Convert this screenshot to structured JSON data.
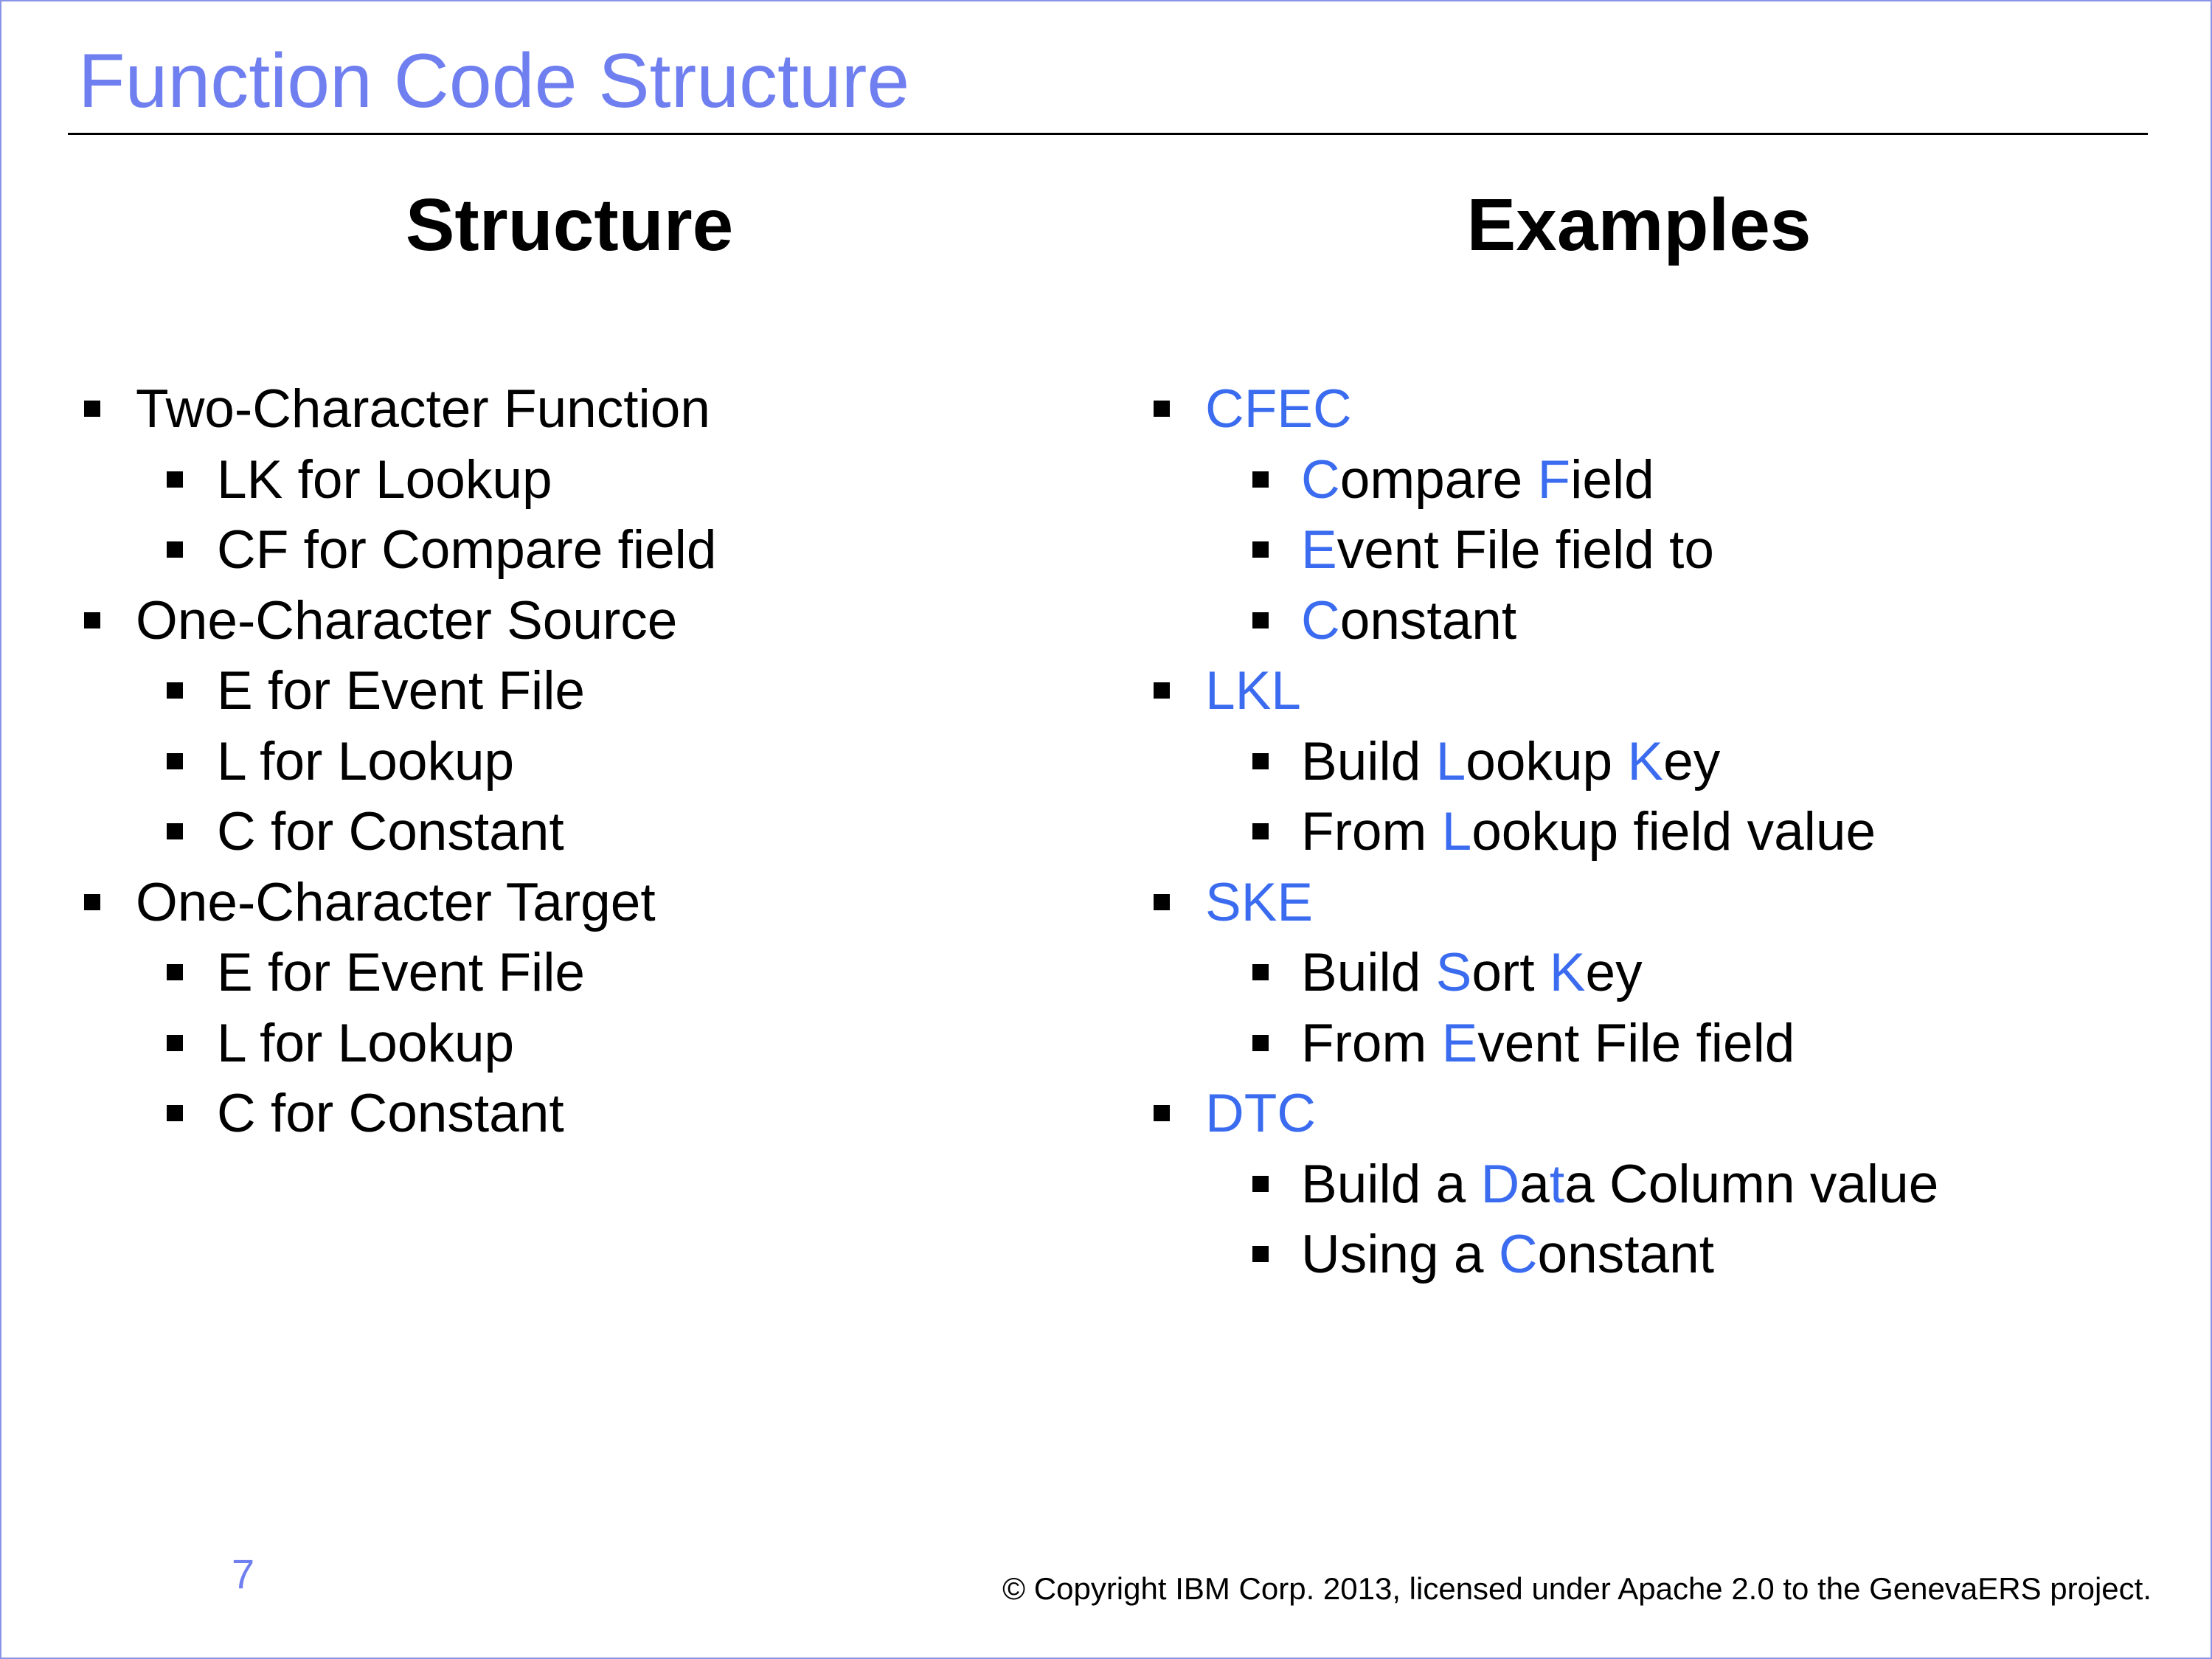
{
  "slide": {
    "title": "Function Code Structure",
    "page_number": "7",
    "copyright": "© Copyright IBM Corp. 2013, licensed under Apache 2.0 to the GenevaERS project."
  },
  "structure": {
    "heading": "Structure",
    "items": [
      {
        "level": 1,
        "segments": [
          {
            "text": "Two-Character Function",
            "highlight": false
          }
        ]
      },
      {
        "level": 2,
        "segments": [
          {
            "text": "LK for Lookup",
            "highlight": false
          }
        ]
      },
      {
        "level": 2,
        "segments": [
          {
            "text": "CF for Compare field",
            "highlight": false
          }
        ]
      },
      {
        "level": 1,
        "segments": [
          {
            "text": "One-Character Source",
            "highlight": false
          }
        ]
      },
      {
        "level": 2,
        "segments": [
          {
            "text": "E for Event File",
            "highlight": false
          }
        ]
      },
      {
        "level": 2,
        "segments": [
          {
            "text": "L for Lookup",
            "highlight": false
          }
        ]
      },
      {
        "level": 2,
        "segments": [
          {
            "text": "C for Constant",
            "highlight": false
          }
        ]
      },
      {
        "level": 1,
        "segments": [
          {
            "text": "One-Character Target",
            "highlight": false
          }
        ]
      },
      {
        "level": 2,
        "segments": [
          {
            "text": "E for Event File",
            "highlight": false
          }
        ]
      },
      {
        "level": 2,
        "segments": [
          {
            "text": "L for Lookup",
            "highlight": false
          }
        ]
      },
      {
        "level": 2,
        "segments": [
          {
            "text": "C for Constant",
            "highlight": false
          }
        ]
      }
    ]
  },
  "examples": {
    "heading": "Examples",
    "items": [
      {
        "level": 1,
        "segments": [
          {
            "text": "CFEC",
            "highlight": true
          }
        ]
      },
      {
        "level": 2,
        "segments": [
          {
            "text": "C",
            "highlight": true
          },
          {
            "text": "ompare ",
            "highlight": false
          },
          {
            "text": "F",
            "highlight": true
          },
          {
            "text": "ield",
            "highlight": false
          }
        ]
      },
      {
        "level": 2,
        "segments": [
          {
            "text": "E",
            "highlight": true
          },
          {
            "text": "vent File field to",
            "highlight": false
          }
        ]
      },
      {
        "level": 2,
        "segments": [
          {
            "text": "C",
            "highlight": true
          },
          {
            "text": "onstant",
            "highlight": false
          }
        ]
      },
      {
        "level": 1,
        "segments": [
          {
            "text": "LKL",
            "highlight": true
          }
        ]
      },
      {
        "level": 2,
        "segments": [
          {
            "text": "Build ",
            "highlight": false
          },
          {
            "text": "L",
            "highlight": true
          },
          {
            "text": "ookup ",
            "highlight": false
          },
          {
            "text": "K",
            "highlight": true
          },
          {
            "text": "ey",
            "highlight": false
          }
        ]
      },
      {
        "level": 2,
        "segments": [
          {
            "text": "From ",
            "highlight": false
          },
          {
            "text": "L",
            "highlight": true
          },
          {
            "text": "ookup field value",
            "highlight": false
          }
        ]
      },
      {
        "level": 1,
        "segments": [
          {
            "text": "SKE",
            "highlight": true
          }
        ]
      },
      {
        "level": 2,
        "segments": [
          {
            "text": "Build ",
            "highlight": false
          },
          {
            "text": "S",
            "highlight": true
          },
          {
            "text": "ort ",
            "highlight": false
          },
          {
            "text": "K",
            "highlight": true
          },
          {
            "text": "ey",
            "highlight": false
          }
        ]
      },
      {
        "level": 2,
        "segments": [
          {
            "text": "From ",
            "highlight": false
          },
          {
            "text": "E",
            "highlight": true
          },
          {
            "text": "vent File field",
            "highlight": false
          }
        ]
      },
      {
        "level": 1,
        "segments": [
          {
            "text": "DTC",
            "highlight": true
          }
        ]
      },
      {
        "level": 2,
        "segments": [
          {
            "text": "Build a ",
            "highlight": false
          },
          {
            "text": "D",
            "highlight": true
          },
          {
            "text": "a",
            "highlight": false
          },
          {
            "text": "t",
            "highlight": true
          },
          {
            "text": "a Column value",
            "highlight": false
          }
        ]
      },
      {
        "level": 2,
        "segments": [
          {
            "text": "Using a ",
            "highlight": false
          },
          {
            "text": "C",
            "highlight": true
          },
          {
            "text": "onstant",
            "highlight": false
          }
        ]
      }
    ]
  },
  "colors": {
    "title": "#6f7ff0",
    "highlight": "#3b6cf0",
    "border": "#8a93e6",
    "text": "#000000"
  }
}
